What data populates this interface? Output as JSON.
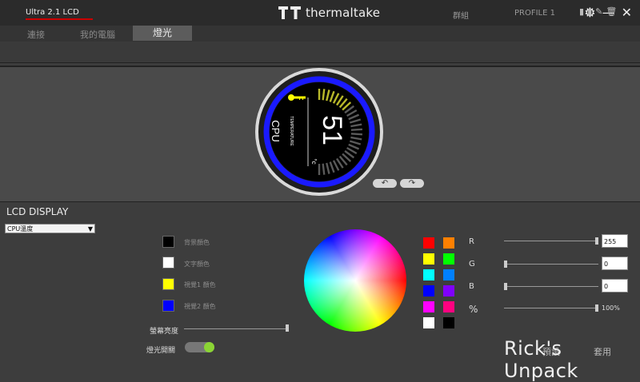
{
  "app": {
    "brand": "thermaltake"
  },
  "tabs": [
    {
      "label": "連接"
    },
    {
      "label": "我的電腦"
    },
    {
      "label": "燈光"
    }
  ],
  "device": {
    "tab": "Ultra 2.1 LCD",
    "group": "群組",
    "profile": "PROFILE 1"
  },
  "preview": {
    "sensor": "CPU",
    "metric": "TEMPERATURE",
    "value": "51",
    "unit": "°c"
  },
  "lcd": {
    "title": "LCD DISPLAY",
    "mode": "CPU溫度",
    "swatches": [
      {
        "label": "背景顏色",
        "color": "#000000"
      },
      {
        "label": "文字顏色",
        "color": "#ffffff"
      },
      {
        "label": "視覺1 顏色",
        "color": "#ffff00"
      },
      {
        "label": "視覺2 顏色",
        "color": "#0000ff"
      }
    ],
    "brightness_label": "螢幕亮度",
    "brightness": 1.0,
    "light_switch_label": "燈光開關",
    "light_switch_on": true
  },
  "palette": [
    "#ff0000",
    "#ff8000",
    "#ffff00",
    "#00ff00",
    "#00ffff",
    "#0080ff",
    "#0000ff",
    "#8000ff",
    "#ff00ff",
    "#ff0080",
    "#ffffff",
    "#000000"
  ],
  "rgb": {
    "r_label": "R",
    "g_label": "G",
    "b_label": "B",
    "pct_label": "%",
    "r": "255",
    "g": "0",
    "b": "0",
    "pct": "100%",
    "r_level": 1.0,
    "g_level": 0.0,
    "b_level": 0.0,
    "pct_level": 1.0
  },
  "footer": {
    "reset": "預設",
    "apply": "套用"
  },
  "watermark": "Rick's Unpack",
  "colors": {
    "accent_red": "#cc0000",
    "ring_blue": "#1a1aff",
    "gauge_yellow": "#b9b92a",
    "toggle_green": "#8bd534"
  }
}
